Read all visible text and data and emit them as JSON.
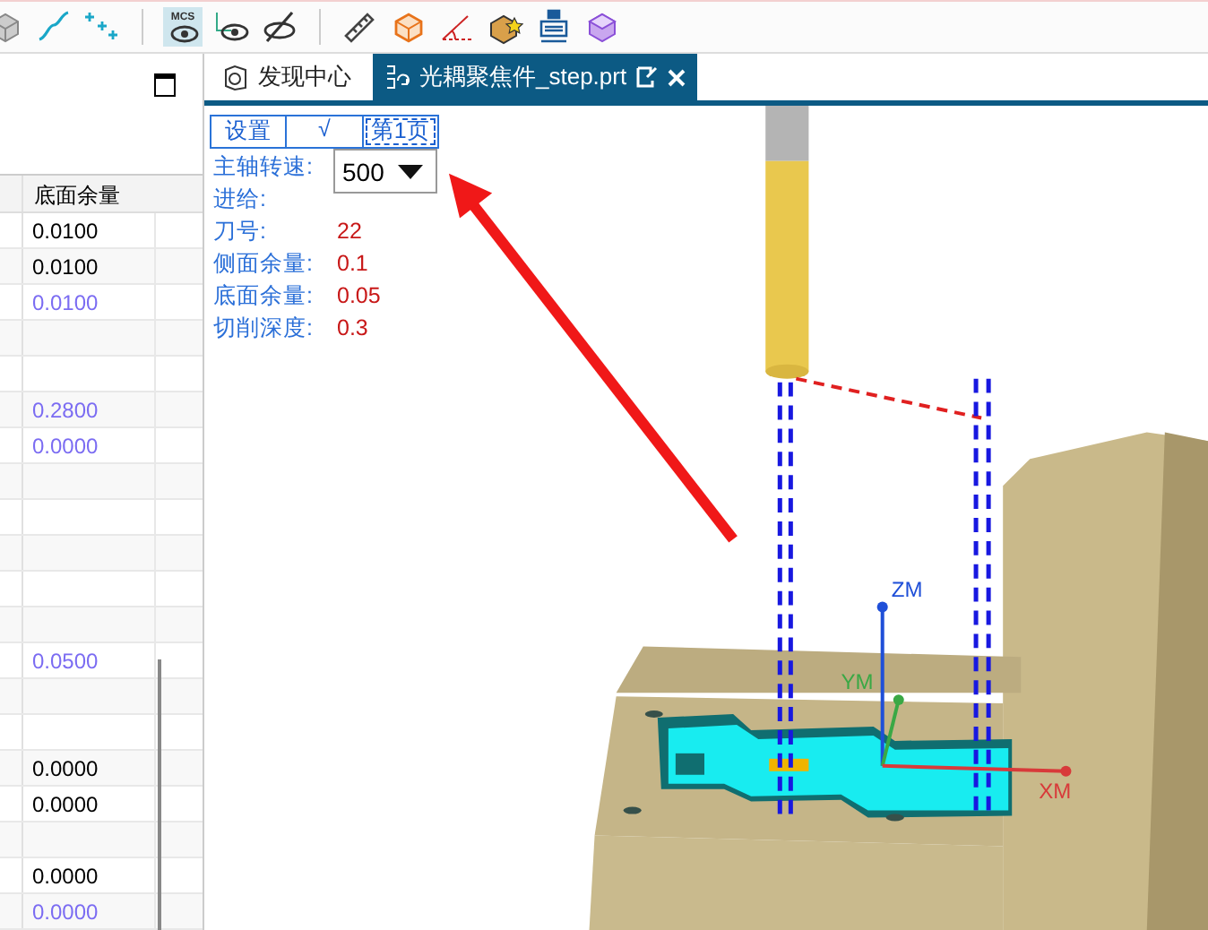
{
  "toolbar": [
    {
      "kind": "solid",
      "selected": false
    },
    {
      "kind": "curve",
      "selected": false
    },
    {
      "kind": "points",
      "selected": false
    },
    {
      "kind": "mcs",
      "label": "MCS",
      "selected": true
    },
    {
      "kind": "eye-axes",
      "selected": false
    },
    {
      "kind": "eye-off",
      "selected": false
    },
    {
      "kind": "ruler",
      "selected": false
    },
    {
      "kind": "cube-orange",
      "selected": false
    },
    {
      "kind": "angle",
      "selected": false
    },
    {
      "kind": "box-star",
      "selected": false
    },
    {
      "kind": "machine",
      "selected": false
    },
    {
      "kind": "cube-purple",
      "selected": false
    }
  ],
  "left_panel": {
    "table": {
      "columns": [
        "底面余量"
      ],
      "rows": [
        {
          "bottom_stock": "0.0100",
          "color": "#000000"
        },
        {
          "bottom_stock": "0.0100",
          "color": "#000000"
        },
        {
          "bottom_stock": "0.0100",
          "color": "#7b6cf2"
        },
        {},
        {},
        {
          "bottom_stock": "0.2800",
          "color": "#7b6cf2"
        },
        {
          "bottom_stock": "0.0000",
          "color": "#7b6cf2"
        },
        {},
        {},
        {},
        {},
        {},
        {
          "bottom_stock": "0.0500",
          "color": "#7b6cf2"
        },
        {},
        {},
        {
          "bottom_stock": "0.0000",
          "color": "#000000"
        },
        {
          "bottom_stock": "0.0000",
          "color": "#000000"
        },
        {},
        {
          "bottom_stock": "0.0000",
          "color": "#000000"
        },
        {
          "bottom_stock": "0.0000",
          "color": "#7b6cf2"
        }
      ]
    }
  },
  "tabs": [
    {
      "label": "发现中心",
      "selected": false
    },
    {
      "label": "光耦聚焦件_step.prt",
      "selected": true
    }
  ],
  "overlay": {
    "header": [
      {
        "label": "设置",
        "focused": false
      },
      {
        "label": "√",
        "focused": false
      },
      {
        "label": "第1页",
        "focused": true
      }
    ],
    "params": [
      {
        "label": "主轴转速:"
      },
      {
        "label": "进给:"
      },
      {
        "label": "刀号:",
        "value": "22"
      },
      {
        "label": "侧面余量:",
        "value": "0.1"
      },
      {
        "label": "底面余量:",
        "value": "0.05"
      },
      {
        "label": "切削深度:",
        "value": "0.3"
      }
    ],
    "dropdown": {
      "value": "500"
    }
  },
  "axes": [
    {
      "label": "ZM",
      "color": "#1f4fd8"
    },
    {
      "label": "YM",
      "color": "#3aa845"
    },
    {
      "label": "XM",
      "color": "#d83a3a"
    }
  ]
}
